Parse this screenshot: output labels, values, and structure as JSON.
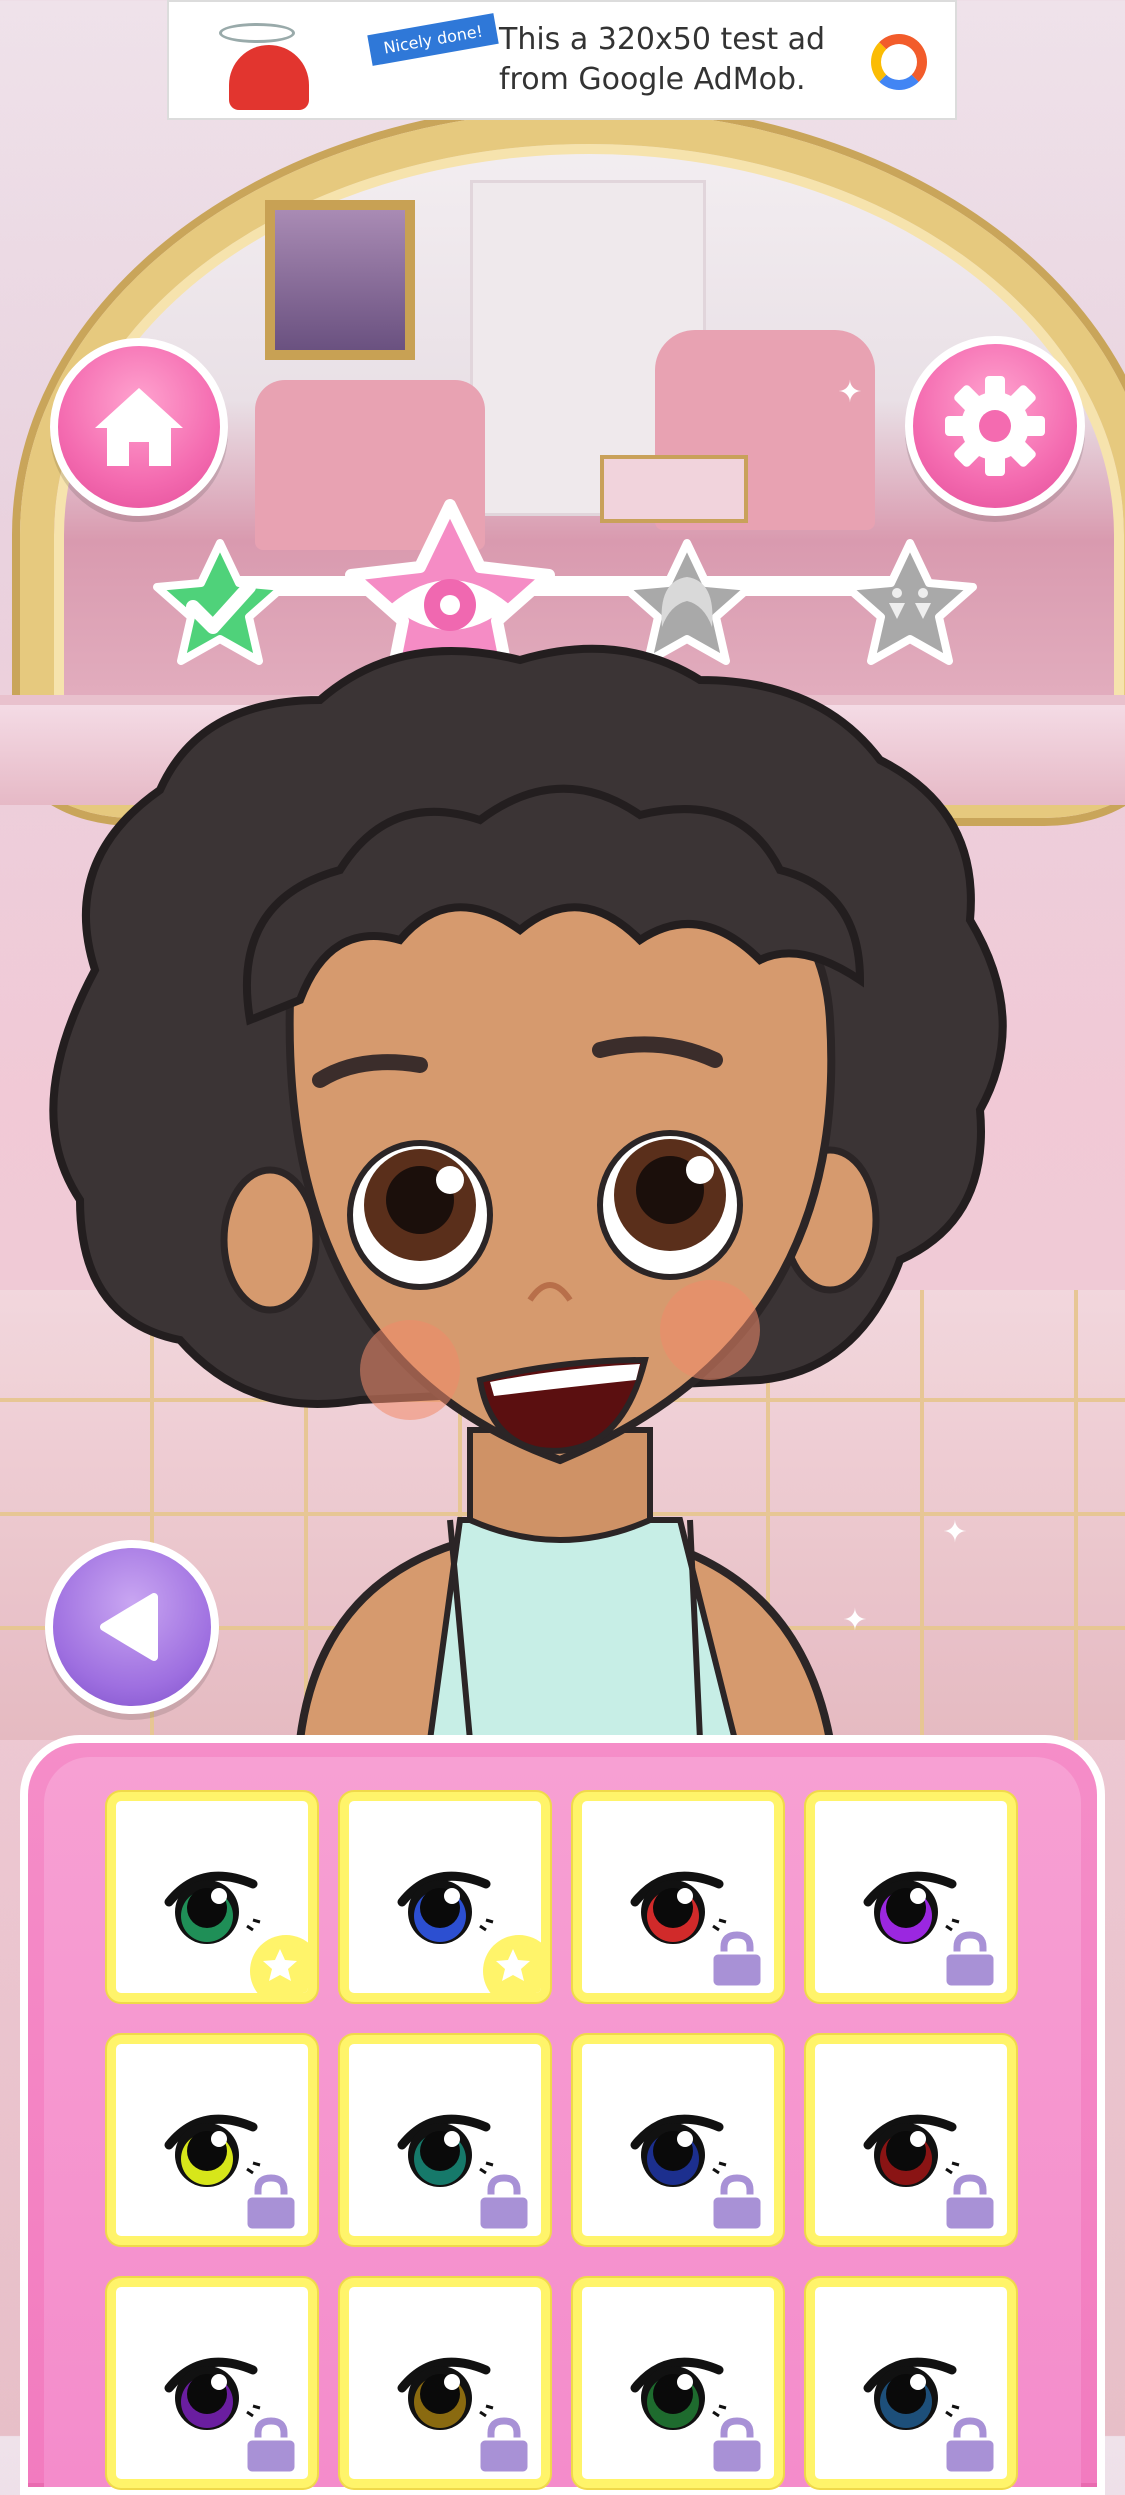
{
  "ad": {
    "tag": "Nicely done!",
    "text_line1": "This a 320x50 test ad",
    "text_line2": "from Google AdMob."
  },
  "buttons": {
    "home_icon": "house-icon",
    "settings_icon": "gear-icon",
    "back_icon": "triangle-left-icon"
  },
  "progress_steps": [
    {
      "icon": "checkmark-icon",
      "state": "completed",
      "color": "#4fd27a"
    },
    {
      "icon": "eye-icon",
      "state": "current",
      "color": "#f58cc5"
    },
    {
      "icon": "hair-icon",
      "state": "locked",
      "color": "#a9a9a9"
    },
    {
      "icon": "earrings-icon",
      "state": "locked",
      "color": "#a9a9a9"
    }
  ],
  "eye_options": [
    {
      "iris": "#1f8f57",
      "status": "favorite"
    },
    {
      "iris": "#2c4fd1",
      "status": "favorite"
    },
    {
      "iris": "#d12a2a",
      "status": "locked"
    },
    {
      "iris": "#9b27e0",
      "status": "locked"
    },
    {
      "iris": "#d7e61a",
      "status": "locked"
    },
    {
      "iris": "#16796a",
      "status": "locked"
    },
    {
      "iris": "#1c2f8e",
      "status": "locked"
    },
    {
      "iris": "#8a1414",
      "status": "locked"
    },
    {
      "iris": "#6a1ea0",
      "status": "locked"
    },
    {
      "iris": "#8a6a10",
      "status": "locked"
    },
    {
      "iris": "#1e6b2e",
      "status": "locked"
    },
    {
      "iris": "#1d4f7a",
      "status": "locked"
    }
  ],
  "colors": {
    "panel": "#f27bbf",
    "cell_border": "#fff46a",
    "lock": "#a891d6"
  }
}
